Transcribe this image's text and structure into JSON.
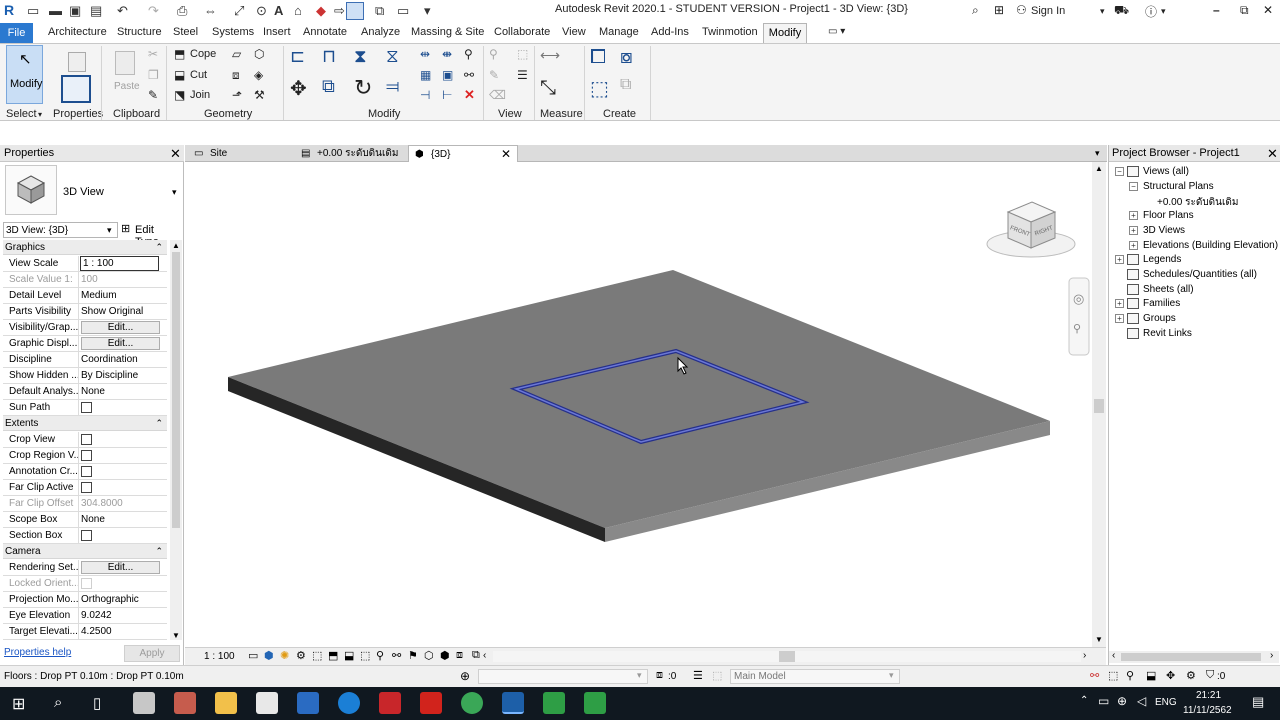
{
  "title_bar": {
    "title": "Autodesk Revit 2020.1 - STUDENT VERSION - Project1 - 3D View: {3D}",
    "sign_in": "Sign In",
    "app_icon": "R"
  },
  "menu_tabs": [
    "File",
    "Architecture",
    "Structure",
    "Steel",
    "Systems",
    "Insert",
    "Annotate",
    "Analyze",
    "Massing & Site",
    "Collaborate",
    "View",
    "Manage",
    "Add-Ins",
    "Twinmotion",
    "Modify"
  ],
  "ribbon": {
    "modify_label": "Modify",
    "select_label": "Select",
    "properties_label": "Properties",
    "paste_label": "Paste",
    "clipboard_label": "Clipboard",
    "cope_label": "Cope",
    "cut_label": "Cut",
    "join_label": "Join",
    "geometry_label": "Geometry",
    "modify_panel_label": "Modify",
    "view_label": "View",
    "measure_label": "Measure",
    "create_label": "Create"
  },
  "properties": {
    "header": "Properties",
    "type_name": "3D View",
    "instance_selector": "3D View: {3D}",
    "edit_type": "Edit Type",
    "groups": [
      {
        "name": "Graphics",
        "rows": [
          {
            "label": "View Scale",
            "value": "1 : 100",
            "kind": "input"
          },
          {
            "label": "Scale Value    1:",
            "value": "100",
            "kind": "gray"
          },
          {
            "label": "Detail Level",
            "value": "Medium",
            "kind": "text"
          },
          {
            "label": "Parts Visibility",
            "value": "Show Original",
            "kind": "text"
          },
          {
            "label": "Visibility/Grap...",
            "value": "Edit...",
            "kind": "button"
          },
          {
            "label": "Graphic Displ...",
            "value": "Edit...",
            "kind": "button"
          },
          {
            "label": "Discipline",
            "value": "Coordination",
            "kind": "text"
          },
          {
            "label": "Show Hidden ...",
            "value": "By Discipline",
            "kind": "text"
          },
          {
            "label": "Default Analys...",
            "value": "None",
            "kind": "text"
          },
          {
            "label": "Sun Path",
            "value": "",
            "kind": "checkbox"
          }
        ]
      },
      {
        "name": "Extents",
        "rows": [
          {
            "label": "Crop View",
            "value": "",
            "kind": "checkbox"
          },
          {
            "label": "Crop Region V...",
            "value": "",
            "kind": "checkbox"
          },
          {
            "label": "Annotation Cr...",
            "value": "",
            "kind": "checkbox"
          },
          {
            "label": "Far Clip Active",
            "value": "",
            "kind": "checkbox"
          },
          {
            "label": "Far Clip Offset",
            "value": "304.8000",
            "kind": "gray"
          },
          {
            "label": "Scope Box",
            "value": "None",
            "kind": "text"
          },
          {
            "label": "Section Box",
            "value": "",
            "kind": "checkbox"
          }
        ]
      },
      {
        "name": "Camera",
        "rows": [
          {
            "label": "Rendering Set...",
            "value": "Edit...",
            "kind": "button"
          },
          {
            "label": "Locked Orient...",
            "value": "",
            "kind": "graycheck"
          },
          {
            "label": "Projection Mo...",
            "value": "Orthographic",
            "kind": "text"
          },
          {
            "label": "Eye Elevation",
            "value": "9.0242",
            "kind": "text"
          },
          {
            "label": "Target Elevati...",
            "value": "4.2500",
            "kind": "text"
          }
        ]
      }
    ],
    "help_link": "Properties help",
    "apply": "Apply"
  },
  "view_tabs": [
    {
      "label": "Site"
    },
    {
      "label": "+0.00 ระดับดินเดิม"
    },
    {
      "label": "{3D}"
    }
  ],
  "viewcube": {
    "front": "FRONT",
    "right": "RIGHT"
  },
  "view_control_bar": {
    "scale": "1 : 100"
  },
  "project_browser": {
    "header": "Project Browser - Project1",
    "nodes": [
      {
        "label": "Views (all)",
        "level": 0,
        "exp": "-"
      },
      {
        "label": "Structural Plans",
        "level": 1,
        "exp": "-"
      },
      {
        "label": "+0.00 ระดับดินเดิม",
        "level": 2,
        "exp": ""
      },
      {
        "label": "Floor Plans",
        "level": 1,
        "exp": "+"
      },
      {
        "label": "3D Views",
        "level": 1,
        "exp": "+"
      },
      {
        "label": "Elevations (Building Elevation)",
        "level": 1,
        "exp": "+"
      },
      {
        "label": "Legends",
        "level": 0,
        "exp": "+"
      },
      {
        "label": "Schedules/Quantities (all)",
        "level": 0,
        "exp": ""
      },
      {
        "label": "Sheets (all)",
        "level": 0,
        "exp": ""
      },
      {
        "label": "Families",
        "level": 0,
        "exp": "+"
      },
      {
        "label": "Groups",
        "level": 0,
        "exp": "+"
      },
      {
        "label": "Revit Links",
        "level": 0,
        "exp": ""
      }
    ]
  },
  "status_bar": {
    "message": "Floors : Drop PT 0.10m : Drop PT 0.10m",
    "zero_a": ":0",
    "model": "Main Model",
    "filter_count": ":0"
  },
  "taskbar": {
    "lang": "ENG",
    "time": "21:21",
    "date": "11/11/2562"
  }
}
